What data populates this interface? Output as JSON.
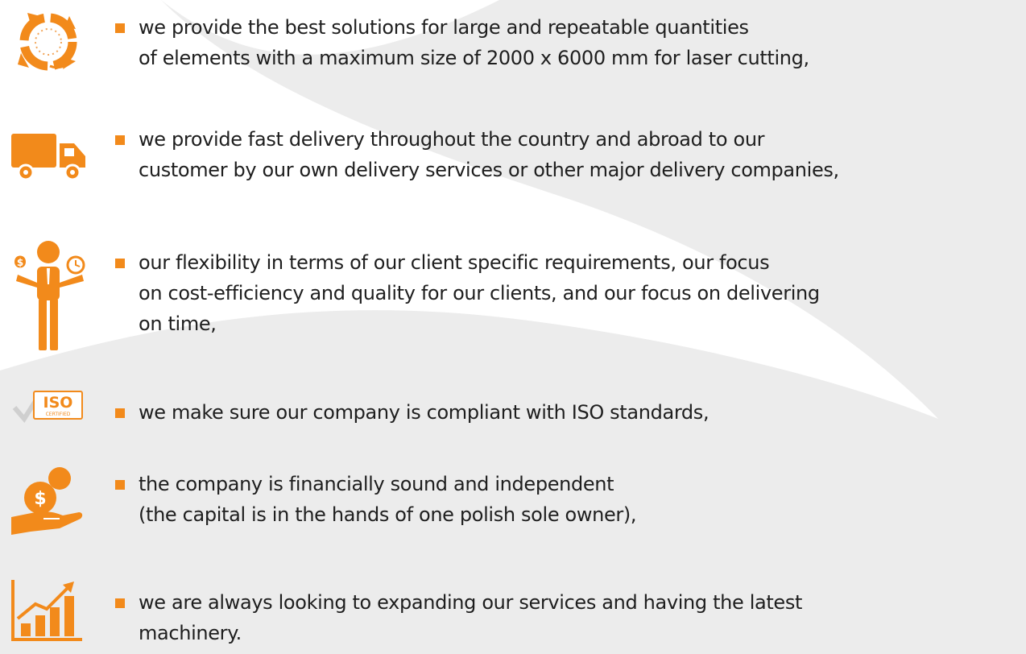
{
  "colors": {
    "accent": "#f28a1b",
    "text": "#1e1e1e",
    "background_shape": "#ececec"
  },
  "items": [
    {
      "icon": "recycle-cycle-icon",
      "text": "we provide the best solutions for large and repeatable quantities\nof elements with a maximum size of 2000 x 6000 mm for laser cutting,"
    },
    {
      "icon": "delivery-truck-icon",
      "text": "we provide fast delivery throughout the country and abroad to our\ncustomer by our own delivery services or other major delivery companies,"
    },
    {
      "icon": "businessman-balance-icon",
      "text": "our flexibility in terms of our client specific requirements, our focus\non cost-efficiency and quality for our clients, and our focus on delivering\non time,"
    },
    {
      "icon": "iso-certified-icon",
      "text": "we make sure our company is compliant with ISO standards,",
      "badge": {
        "title": "ISO",
        "subtitle": "CERTIFIED"
      }
    },
    {
      "icon": "money-hand-icon",
      "text": "the company is financially sound and independent\n(the capital is in the hands of one polish sole owner),"
    },
    {
      "icon": "growth-chart-icon",
      "text": "we are always looking to expanding our services and having the latest\nmachinery."
    }
  ]
}
